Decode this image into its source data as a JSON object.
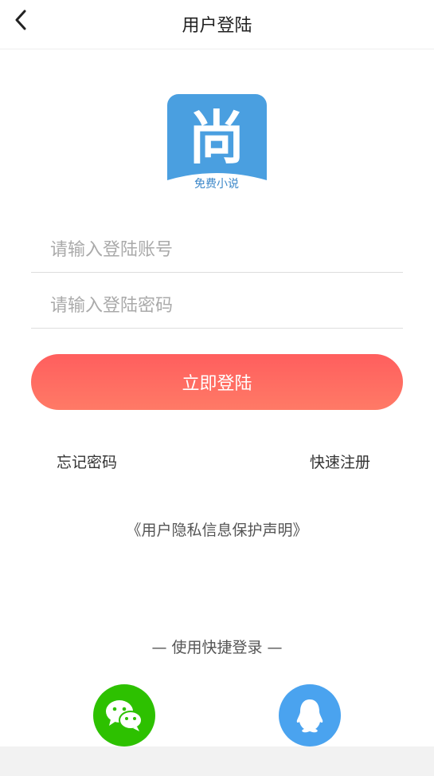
{
  "header": {
    "title": "用户登陆"
  },
  "logo": {
    "char": "尚",
    "subtitle": "免费小说",
    "bg_color": "#4a9fe0"
  },
  "form": {
    "account_placeholder": "请输入登陆账号",
    "password_placeholder": "请输入登陆密码",
    "login_label": "立即登陆",
    "button_color": "#ff5f5f"
  },
  "links": {
    "forgot_password": "忘记密码",
    "quick_register": "快速注册",
    "privacy": "《用户隐私信息保护声明》"
  },
  "quick_login": {
    "label": "— 使用快捷登录 —",
    "wechat_color": "#2dc100",
    "qq_color": "#4aa3ef"
  }
}
